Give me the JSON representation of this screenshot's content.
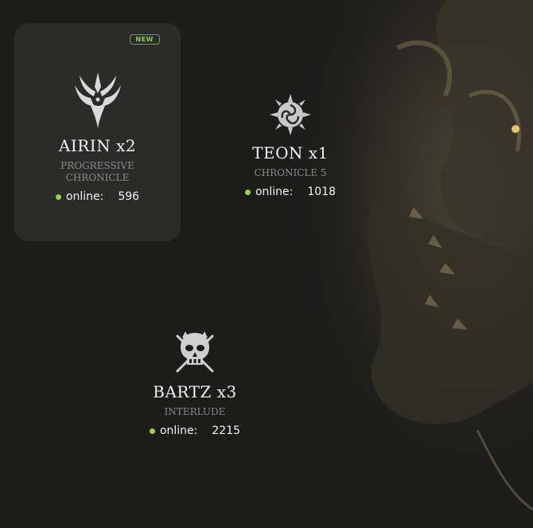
{
  "servers": [
    {
      "name": "AIRIN x2",
      "chronicle_line1": "PROGRESSIVE",
      "chronicle_line2": "CHRONICLE",
      "online_label": "online:",
      "online_count": "596",
      "badge": "NEW",
      "emblem": "winged-crest-icon"
    },
    {
      "name": "TEON x1",
      "chronicle": "CHRONICLE 5",
      "online_label": "online:",
      "online_count": "1018",
      "emblem": "triskelion-sun-icon"
    },
    {
      "name": "BARTZ x3",
      "chronicle": "INTERLUDE",
      "online_label": "online:",
      "online_count": "2215",
      "emblem": "skull-crossed-swords-icon"
    }
  ],
  "colors": {
    "online_dot": "#9ad33a",
    "badge": "#6aa53a",
    "card_bg": "#2b2b2a",
    "page_bg": "#1c1c1b"
  }
}
